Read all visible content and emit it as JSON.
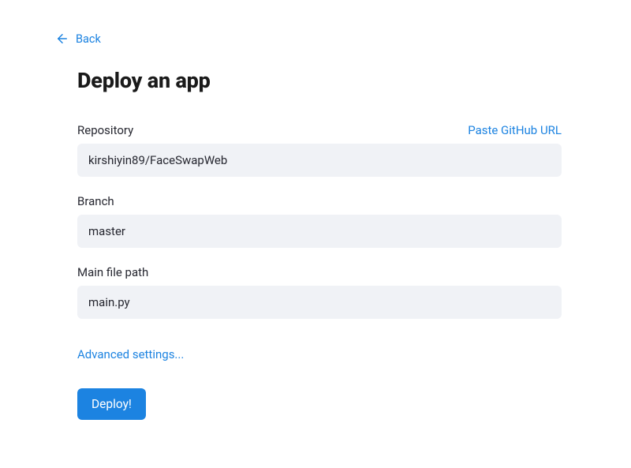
{
  "nav": {
    "back_label": "Back"
  },
  "page": {
    "title": "Deploy an app"
  },
  "form": {
    "repository": {
      "label": "Repository",
      "paste_link": "Paste GitHub URL",
      "value": "kirshiyin89/FaceSwapWeb"
    },
    "branch": {
      "label": "Branch",
      "value": "master"
    },
    "main_file": {
      "label": "Main file path",
      "value": "main.py"
    },
    "advanced_link": "Advanced settings...",
    "deploy_button": "Deploy!"
  },
  "colors": {
    "accent": "#1c83e1",
    "input_bg": "#f0f2f6"
  }
}
